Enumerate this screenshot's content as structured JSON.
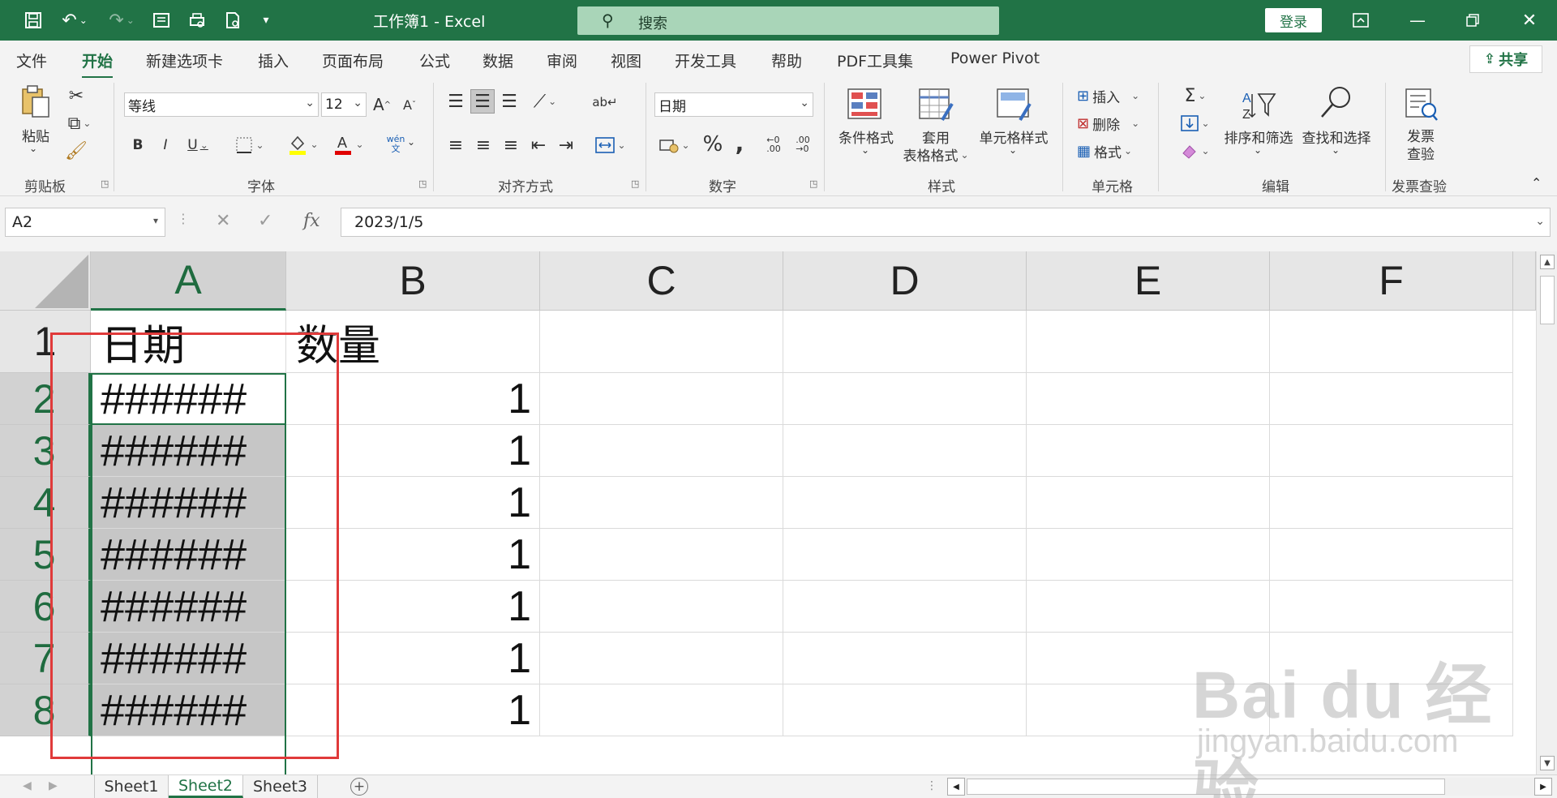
{
  "app": {
    "doc_title": "工作簿1  -  Excel",
    "search_placeholder": "搜索",
    "login_label": "登录"
  },
  "tabs": [
    "文件",
    "开始",
    "新建选项卡",
    "插入",
    "页面布局",
    "公式",
    "数据",
    "审阅",
    "视图",
    "开发工具",
    "帮助",
    "PDF工具集",
    "Power Pivot"
  ],
  "active_tab": "开始",
  "share_label": "共享",
  "ribbon": {
    "clipboard": {
      "paste": "粘贴",
      "group": "剪贴板"
    },
    "font": {
      "name": "等线",
      "size": "12",
      "wen": "wén",
      "wen2": "文",
      "group": "字体"
    },
    "align": {
      "group": "对齐方式"
    },
    "number": {
      "format": "日期",
      "group": "数字"
    },
    "styles": {
      "cond": "条件格式",
      "table1": "套用",
      "table2": "表格格式",
      "cell": "单元格样式",
      "group": "样式"
    },
    "cells": {
      "insert": "插入",
      "delete": "删除",
      "format": "格式",
      "group": "单元格"
    },
    "editing": {
      "sort": "排序和筛选",
      "find": "查找和选择",
      "group": "编辑"
    },
    "invoice": {
      "l1": "发票",
      "l2": "查验",
      "group": "发票查验"
    }
  },
  "formula_bar": {
    "name_box": "A2",
    "fx": "fx",
    "value": "2023/1/5"
  },
  "columns": [
    "A",
    "B",
    "C",
    "D",
    "E",
    "F"
  ],
  "rows": [
    {
      "num": "1",
      "a": "日期",
      "b": "数量"
    },
    {
      "num": "2",
      "a": "######",
      "b": "1"
    },
    {
      "num": "3",
      "a": "######",
      "b": "1"
    },
    {
      "num": "4",
      "a": "######",
      "b": "1"
    },
    {
      "num": "5",
      "a": "######",
      "b": "1"
    },
    {
      "num": "6",
      "a": "######",
      "b": "1"
    },
    {
      "num": "7",
      "a": "######",
      "b": "1"
    },
    {
      "num": "8",
      "a": "######",
      "b": "1"
    }
  ],
  "sheets": [
    "Sheet1",
    "Sheet2",
    "Sheet3"
  ],
  "active_sheet": "Sheet2",
  "watermark": {
    "logo": "Bai du 经验",
    "url": "jingyan.baidu.com"
  },
  "colors": {
    "excel_green": "#217346",
    "highlight_red": "#e03a3a"
  }
}
